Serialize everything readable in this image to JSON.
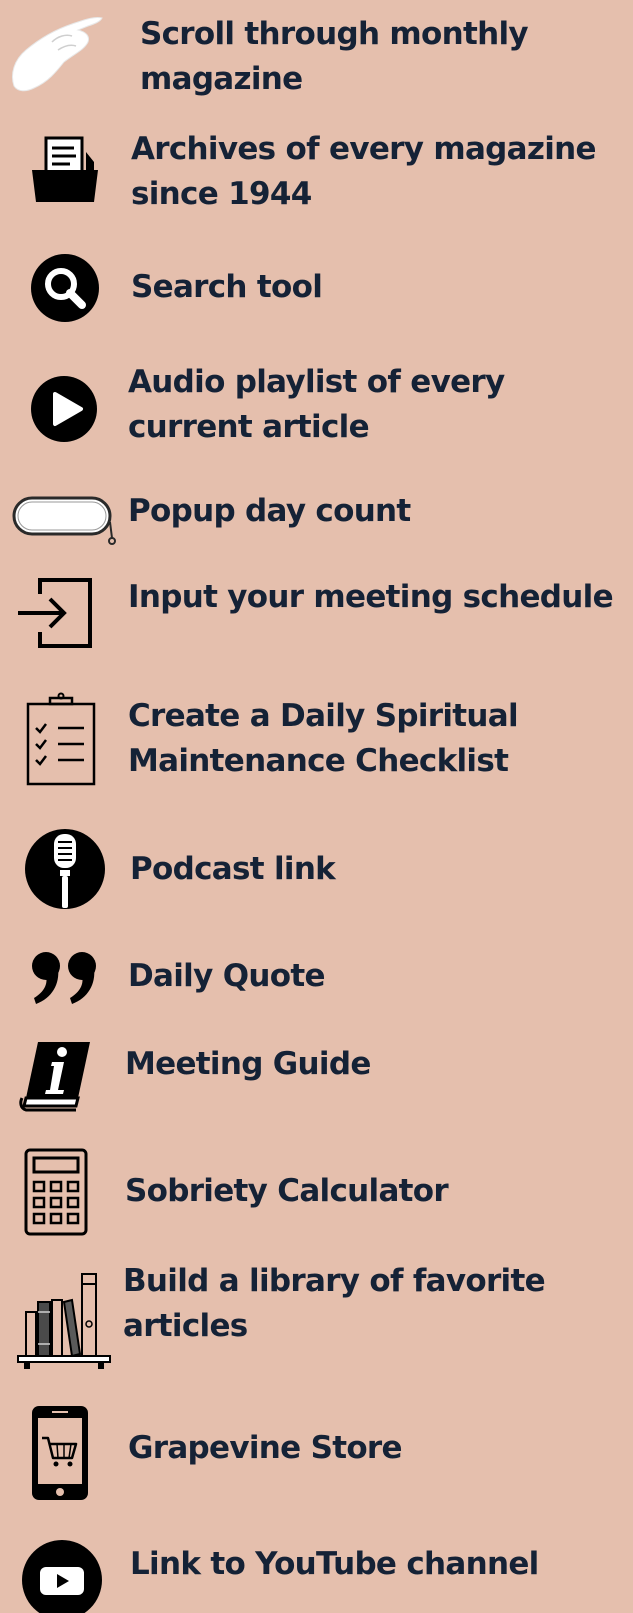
{
  "colors": {
    "background": "#e5bfad",
    "text": "#152236",
    "icon": "#000000"
  },
  "features": [
    {
      "id": "scroll",
      "icon": "pointing-hand-icon",
      "line1": "Scroll through monthly",
      "line2": "magazine"
    },
    {
      "id": "archives",
      "icon": "archive-box-icon",
      "line1": "Archives of every magazine",
      "line2": "since 1944"
    },
    {
      "id": "search",
      "icon": "search-icon",
      "line1": "Search tool",
      "line2": ""
    },
    {
      "id": "audio",
      "icon": "play-icon",
      "line1": "Audio playlist of every",
      "line2": "current article"
    },
    {
      "id": "popup",
      "icon": "popup-pill-icon",
      "line1": "Popup day count",
      "line2": ""
    },
    {
      "id": "input",
      "icon": "sign-in-icon",
      "line1": "Input your meeting schedule",
      "line2": ""
    },
    {
      "id": "checklist",
      "icon": "clipboard-checklist-icon",
      "line1": "Create a Daily Spiritual",
      "line2": "Maintenance Checklist"
    },
    {
      "id": "podcast",
      "icon": "microphone-icon",
      "line1": "Podcast link",
      "line2": ""
    },
    {
      "id": "quote",
      "icon": "quote-icon",
      "line1": "Daily Quote",
      "line2": ""
    },
    {
      "id": "guide",
      "icon": "info-book-icon",
      "line1": "Meeting Guide",
      "line2": ""
    },
    {
      "id": "calculator",
      "icon": "calculator-icon",
      "line1": "Sobriety Calculator",
      "line2": ""
    },
    {
      "id": "library",
      "icon": "bookshelf-icon",
      "line1": "Build a library of favorite",
      "line2": "articles"
    },
    {
      "id": "store",
      "icon": "shopping-cart-phone-icon",
      "line1": "Grapevine Store",
      "line2": ""
    },
    {
      "id": "youtube",
      "icon": "youtube-icon",
      "line1": "Link to YouTube channel",
      "line2": ""
    }
  ]
}
